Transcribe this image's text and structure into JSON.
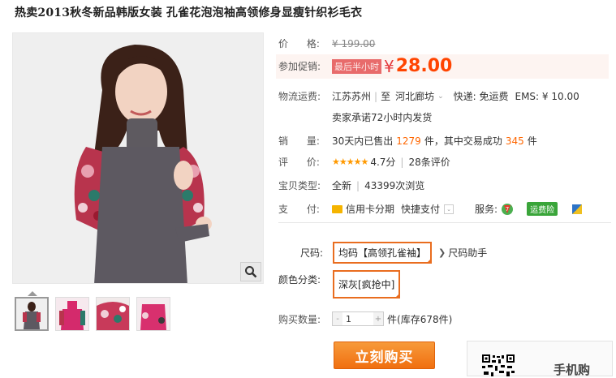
{
  "title": "热卖2013秋冬新品韩版女装 孔雀花泡泡袖高领修身显瘦针织衫毛衣",
  "price": {
    "label": "价      格:",
    "original": "¥ 199.00"
  },
  "promo": {
    "label": "参加促销:",
    "tag": "最后半小时",
    "yuan": "¥",
    "value": "28.00"
  },
  "shipping": {
    "label": "物流运费:",
    "from": "江苏苏州",
    "to_word": "至",
    "to": "河北廊坊",
    "express": "快递: 免运费",
    "ems": "EMS: ¥ 10.00",
    "promise": "卖家承诺72小时内发货"
  },
  "sales": {
    "label": "销      量:",
    "prefix": "30天内已售出",
    "sold": "1279",
    "mid": "件，其中交易成功",
    "success": "345",
    "suffix": "件"
  },
  "rating": {
    "label": "评      价:",
    "stars": "★★★★★",
    "score": "4.7分",
    "count": "28条评价"
  },
  "type": {
    "label": "宝贝类型:",
    "condition": "全新",
    "views": "43399次浏览"
  },
  "payment": {
    "label": "支      付:",
    "credit": "信用卡分期",
    "quick": "快捷支付",
    "service_label": "服务:",
    "insurance": "运费险"
  },
  "size": {
    "label": "尺码:",
    "value": "均码【高领孔雀袖】",
    "helper": "尺码助手"
  },
  "color": {
    "label": "颜色分类:",
    "value": "深灰[疯抢中]"
  },
  "quantity": {
    "label": "购买数量:",
    "value": "1",
    "minus": "-",
    "plus": "+",
    "unit": "件",
    "stock": "(库存678件)"
  },
  "buy_button": "立刻购买",
  "mobile": {
    "label": "手机购"
  },
  "colors": {
    "accent": "#ff4400",
    "button": "#f07014",
    "border": "#e96d1f"
  }
}
